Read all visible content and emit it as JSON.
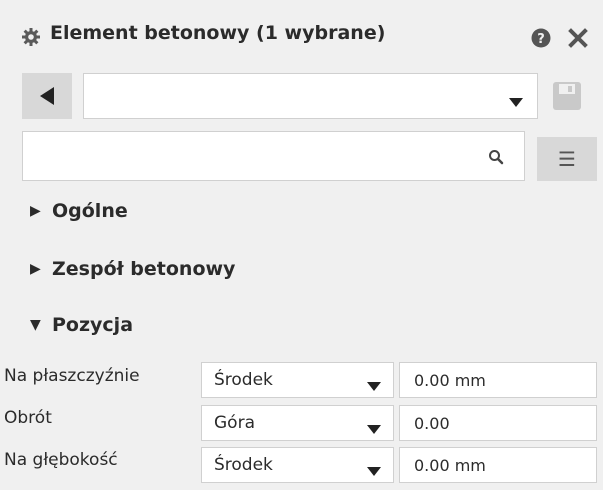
{
  "header": {
    "title": "Element betonowy (1 wybrane)",
    "gear_icon": "gear-icon",
    "help_icon": "help-icon",
    "close_icon": "close-icon"
  },
  "toolbar": {
    "back_icon": "back-arrow-icon",
    "preset_value": "",
    "save_icon": "save-icon"
  },
  "search": {
    "value": "",
    "placeholder": "",
    "icon": "search-icon",
    "menu_icon": "menu-icon",
    "menu_glyph": "☰"
  },
  "sections": [
    {
      "label": "Ogólne",
      "expanded": false,
      "glyph": "▶"
    },
    {
      "label": "Zespół betonowy",
      "expanded": false,
      "glyph": "▶"
    },
    {
      "label": "Pozycja",
      "expanded": true,
      "glyph": "▼"
    }
  ],
  "properties": [
    {
      "label": "Na płaszczyźnie",
      "option": "Środek",
      "value": "0.00 mm"
    },
    {
      "label": "Obrót",
      "option": "Góra",
      "value": "0.00"
    },
    {
      "label": "Na głębokość",
      "option": "Środek",
      "value": "0.00 mm"
    }
  ],
  "colors": {
    "background": "#f0f0f0",
    "field": "#ffffff",
    "button": "#d8d8d8",
    "text": "#2b2b2b"
  }
}
